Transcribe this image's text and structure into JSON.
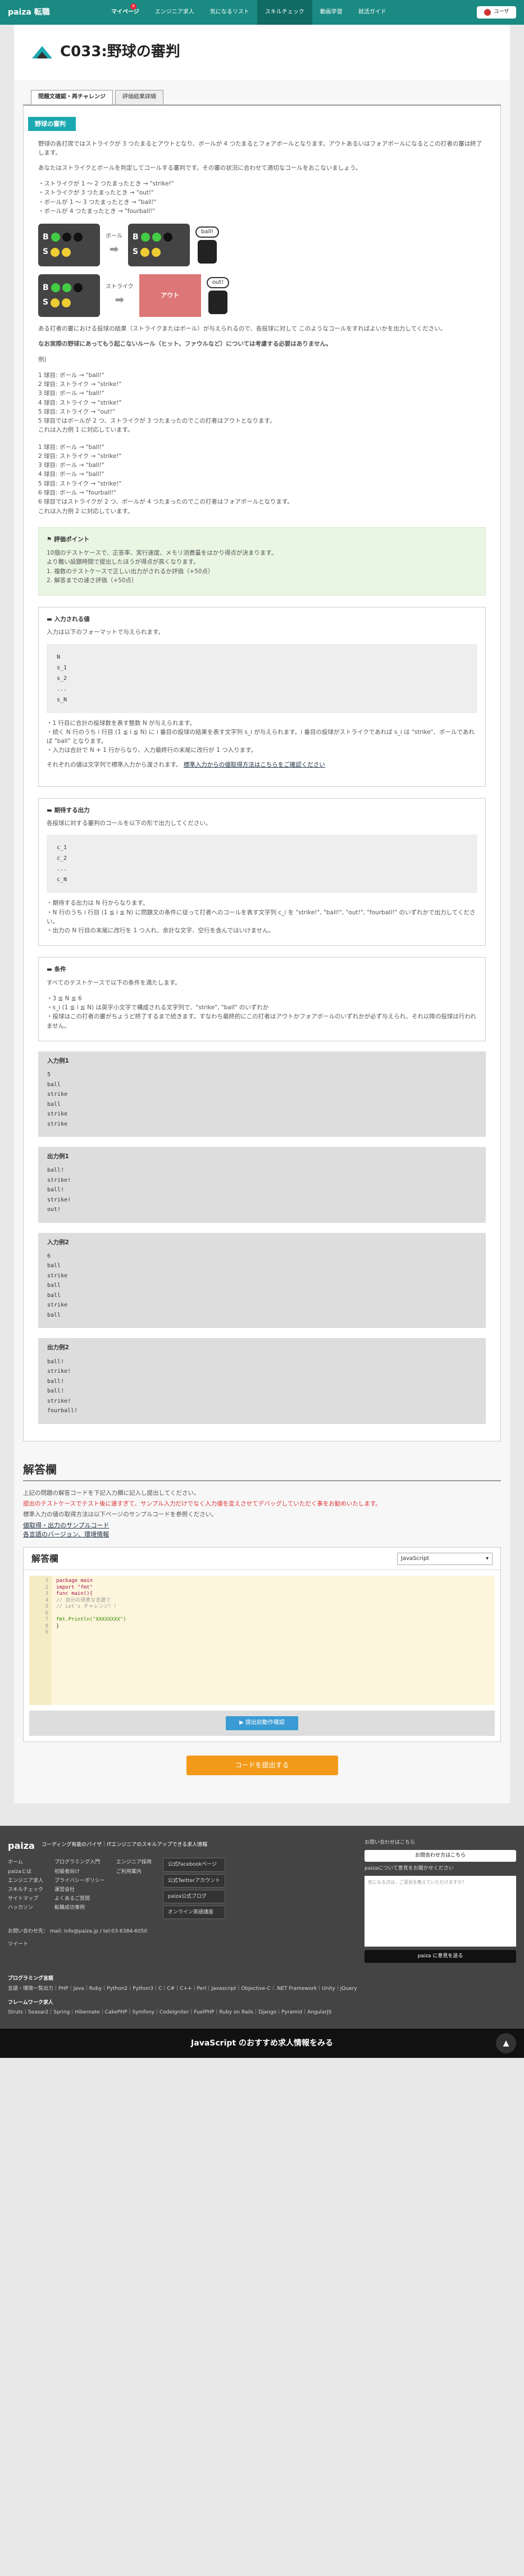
{
  "header": {
    "logo": "paiza 転職",
    "nav": [
      "マイページ",
      "エンジニア求人",
      "気になるリスト",
      "スキルチェック",
      "動画学習",
      "就活ガイド"
    ],
    "badge": "9",
    "user": "ユーザ"
  },
  "page": {
    "title": "C033:野球の審判"
  },
  "tabs": [
    "問題文確認・再チャレンジ",
    "評価結果詳細"
  ],
  "problem": {
    "ribbon": "野球の審判",
    "intro1": "野球の各打席ではストライクが 3 つたまるとアウトとなり、ボールが 4 つたまるとフォアボールとなります。アウトあるいはフォアボールになるとこの打者の審は終了します。",
    "intro2": "あなたはストライクとボールを判定してコールする審判です。その審の状況に合わせて適切なコールをおこないましょう。",
    "rules": [
      "・ストライクが 1 ～ 2 つたまったとき → \"strike!\"",
      "・ストライクが 3 つたまったとき → \"out!\"",
      "・ボールが 1 ～ 3 つたまったとき → \"ball!\"",
      "・ボールが 4 つたまったとき → \"fourball!\""
    ],
    "diag": {
      "ball_label": "ボール",
      "strike_label": "ストライク",
      "out_box": "アウト",
      "call1": "ball!",
      "call2": "out!"
    },
    "desc": "ある打者の審における投球の結果（ストライクまたはボール）が与えられるので、各投球に対して このようなコールをすればよいかを出力してください。",
    "note": "なお実際の野球にあってもう起こないルール（ヒット、ファウルなど）については考慮する必要はありません。",
    "ex_label": "例)",
    "ex1": [
      "1 球目: ボール → \"ball!\"",
      "2 球目: ストライク → \"strike!\"",
      "3 球目: ボール → \"ball!\"",
      "4 球目: ストライク → \"strike!\"",
      "5 球目: ストライク → \"out!\"",
      "5 球目ではボールが 2 つ、ストライクが 3 つたまったのでこの打者はアウトとなります。",
      "これは入力例 1 に対応しています。"
    ],
    "ex2": [
      "1 球目: ボール → \"ball!\"",
      "2 球目: ストライク → \"strike!\"",
      "3 球目: ボール → \"ball!\"",
      "4 球目: ボール → \"ball!\"",
      "5 球目: ストライク → \"strike!\"",
      "6 球目: ボール → \"fourball!\"",
      "6 球目ではストライクが 2 つ、ボールが 4 つたまったのでこの打者はフォアボールとなります。",
      "これは入力例 2 に対応しています。"
    ]
  },
  "evaluation": {
    "title": "評価ポイント",
    "lines": [
      "10個のテストケースで、正答率、実行速度、メモリ消費量をはかり得点が決まります。",
      "より難い設題時間で提出したほうが得点が高くなります。",
      "1. 複数のテストケースで正しい出力がされるか評価（+50点）",
      "2. 解答までの速さ評価（+50点）"
    ]
  },
  "input": {
    "title": "入力される値",
    "desc": "入力は以下のフォーマットで与えられます。",
    "code": [
      "N",
      "s_1",
      "s_2",
      "...",
      "s_N"
    ],
    "notes": [
      "・1 行目に合計の投球数を表す整数 N が与えられます。",
      "・続く N 行のうち i 行目 (1 ≦ i ≦ N) に i 番目の投球の結果を表す文字列 s_i が与えられます。i 番目の投球がストライクであれば s_i は \"strike\"、ボールであれば \"ball\" となります。",
      "・入力は合計で N + 1 行からなり、入力最終行の末尾に改行が 1 つ入ります。"
    ],
    "std_text": "それぞれの値は文字列で標準入力から渡されます。",
    "std_link": "標準入力からの値取得方法はこちらをご確認ください"
  },
  "output": {
    "title": "期待する出力",
    "desc": "各投球に対する審判のコールを以下の形で出力してください。",
    "code": [
      "c_1",
      "c_2",
      "...",
      "c_N"
    ],
    "notes": [
      "・期待する出力は N 行からなります。",
      "・N 行のうち i 行目 (1 ≦ i ≦ N) に問題文の条件に従って打者へのコールを表す文字列 c_i を \"strike!\", \"ball!\", \"out!\", \"fourball!\" のいずれかで出力してください。",
      "・出力の N 行目の末尾に改行を 1 つ入れ、余計な文字、空行を含んではいけません。"
    ]
  },
  "conditions": {
    "title": "条件",
    "desc": "すべてのテストケースで以下の条件を満たします。",
    "lines": [
      "・3 ≦ N ≦ 6",
      "・s_i (1 ≦ i ≦ N) は英字小文字で構成される文字列で、\"strike\", \"ball\" のいずれか",
      "・投球はこの打者の審がちょうど終了するまで続きます。すなわち最終的にこの打者はアウトかフォアボールのいずれかが必ず与えられ、それ以降の投球は行われません。"
    ]
  },
  "examples": [
    {
      "title": "入力例1",
      "values": [
        "5",
        "ball",
        "strike",
        "ball",
        "strike",
        "strike"
      ]
    },
    {
      "title": "出力例1",
      "values": [
        "ball!",
        "strike!",
        "ball!",
        "strike!",
        "out!"
      ]
    },
    {
      "title": "入力例2",
      "values": [
        "6",
        "ball",
        "strike",
        "ball",
        "ball",
        "strike",
        "ball"
      ]
    },
    {
      "title": "出力例2",
      "values": [
        "ball!",
        "strike!",
        "ball!",
        "ball!",
        "strike!",
        "fourball!"
      ]
    }
  ],
  "answer": {
    "title": "解答欄",
    "line1": "上記の問題の解答コードを下記入力欄に記入し提出してください。",
    "line2": "提出のテストケースでテスト後に速すぎて、サンプル入力だけでなく入力値を変えさせてデバッグしていただく事をお勧めいたします。",
    "line3": "標準入力の値の取得方法は以下ページのサンプルコードを参照ください。",
    "link1": "値取得・出力のサンプルコード",
    "link2": "各言語のバージョン、環境情報",
    "editor_title": "解答欄",
    "language": "JavaScript",
    "code": [
      "package main",
      "import \"fmt\"",
      "func main(){",
      "  // 自分の得意な言語で",
      "  // Let's チャレンジ！！",
      "",
      "  fmt.Println(\"XXXXXXXX\")",
      "}"
    ],
    "run_label": "▶ 提出前動作確認",
    "submit_label": "コードを提出する"
  },
  "footer": {
    "logo": "paiza",
    "tagline": "コーディング有能のパイザ｜ITエンジニアのスキルアップできる求人情報",
    "cols": [
      [
        "ホーム",
        "paizaとは",
        "エンジニア求人",
        "スキルチェック",
        "サイトマップ",
        "ハッカソン"
      ],
      [
        "プログラミング入門",
        "初級者向け",
        "プライバシーポリシー",
        "運営会社",
        "よくあるご質問",
        "転職成功事例"
      ],
      [
        "エンジニア採用",
        "ご利用案内"
      ]
    ],
    "social": [
      "公式Facebookページ",
      "公式Twitterアカウント",
      "paiza公式ブログ",
      "オンライン英語講座"
    ],
    "contact": "お問い合わせ先：  mail: info@paiza.jp / tel:03-6384-6050",
    "tweet": "ツイート",
    "side_title": "お問い合わせはこちら",
    "side_btn": "お問合わせ方はこちら",
    "side_label": "paizaについて意見をお聞かせください",
    "side_placeholder": "気になる点は、ご意見を教えていただけますか？",
    "send": "paiza に意見を送る",
    "langs_title": "プログラミング言語",
    "langs": "言語・環境一覧出力｜PHP｜Java｜Ruby｜Python2｜Python3｜C｜C#｜C++｜Perl｜Javascript｜Objective-C｜.NET Framework｜Unity｜jQuery",
    "fw_title": "フレームワーク求人",
    "fw": "Struts｜Seasar2｜Spring｜Hibernate｜CakePHP｜Symfony｜CodeIgniter｜FuelPHP｜Ruby on Rails｜Django｜Pyramid｜AngularJS"
  },
  "bottom": "JavaScript のおすすめ求人情報をみる",
  "colors": {
    "accent": "#1a8a82",
    "submit": "#f39a1a",
    "run": "#3a9bd5"
  }
}
